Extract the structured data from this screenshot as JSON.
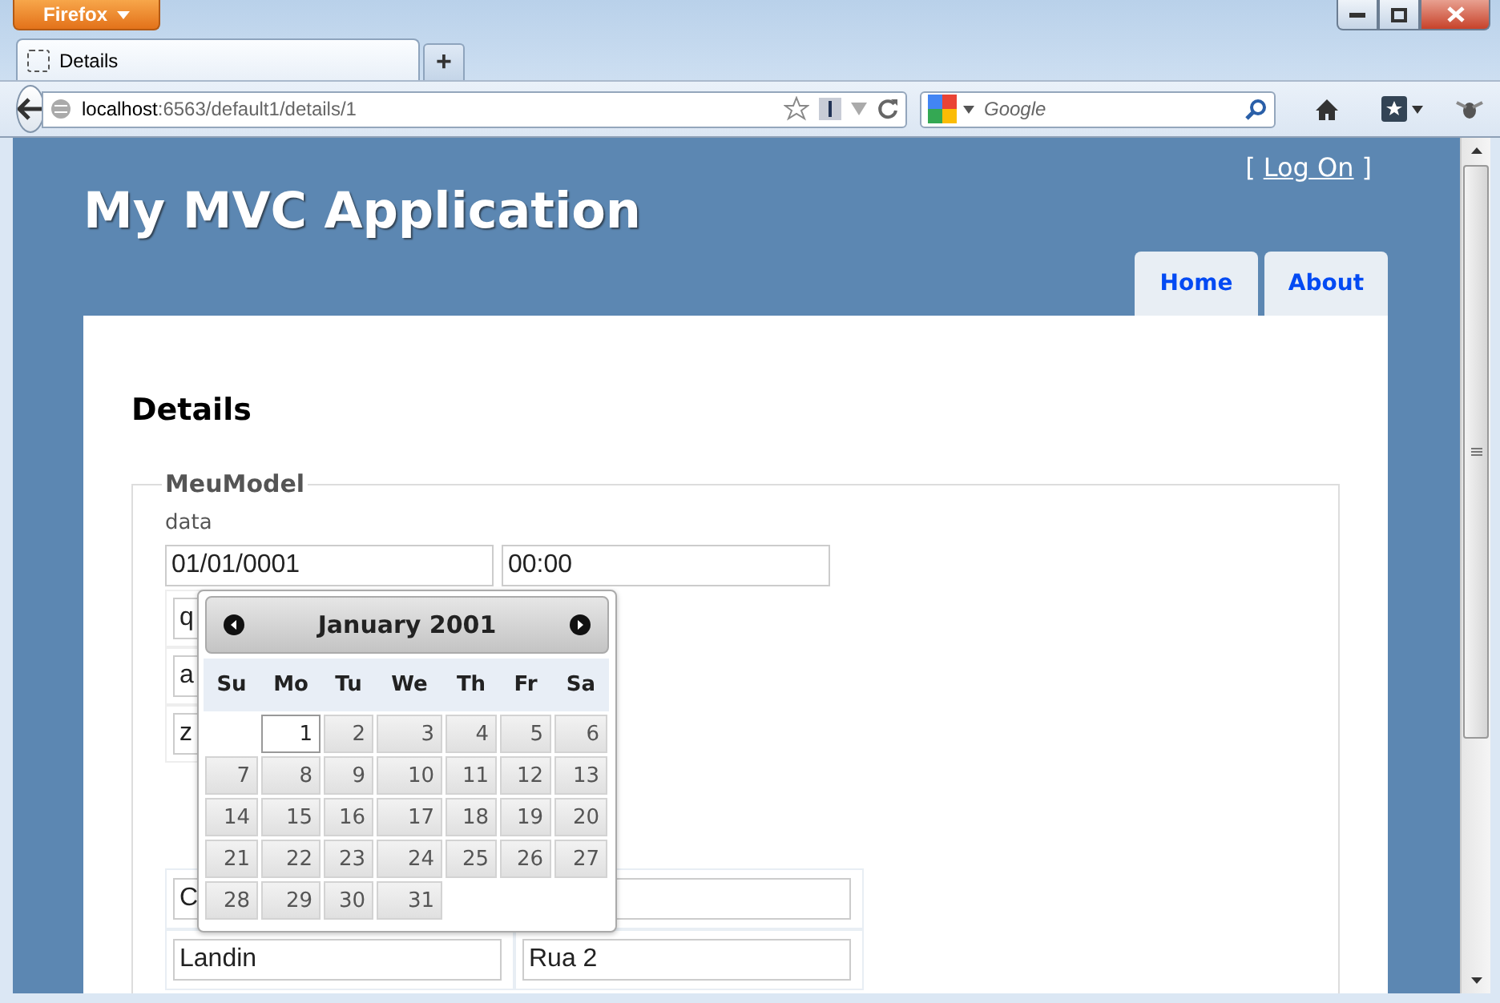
{
  "browser": {
    "menu_button": "Firefox",
    "tabs": [
      {
        "label": "Details",
        "selected": true
      }
    ],
    "new_tab": "+",
    "url_host": "localhost",
    "url_path": ":6563/default1/details/1",
    "search_placeholder": "Google"
  },
  "site": {
    "title": "My MVC Application",
    "login_open": "[",
    "login_link": "Log On",
    "login_close": "]",
    "nav": [
      {
        "label": "Home"
      },
      {
        "label": "About"
      }
    ]
  },
  "page": {
    "heading": "Details",
    "legend": "MeuModel",
    "date_label": "data",
    "date_value": "01/01/0001",
    "time_value": "00:00",
    "fields": [
      "q",
      "a",
      "z"
    ],
    "table": [
      {
        "cells": [
          "C"
        ]
      },
      {
        "cells": [
          "Landin",
          "Rua 2"
        ]
      }
    ]
  },
  "datepicker": {
    "title": "January 2001",
    "weekdays": [
      "Su",
      "Mo",
      "Tu",
      "We",
      "Th",
      "Fr",
      "Sa"
    ],
    "weeks": [
      [
        {
          "kind": "empty"
        },
        {
          "kind": "day",
          "label": "1",
          "selected": true
        },
        {
          "kind": "day",
          "label": "2",
          "selected": false
        },
        {
          "kind": "day",
          "label": "3",
          "selected": false
        },
        {
          "kind": "day",
          "label": "4",
          "selected": false
        },
        {
          "kind": "day",
          "label": "5",
          "selected": false
        },
        {
          "kind": "day",
          "label": "6",
          "selected": false
        }
      ],
      [
        {
          "kind": "day",
          "label": "7",
          "selected": false
        },
        {
          "kind": "day",
          "label": "8",
          "selected": false
        },
        {
          "kind": "day",
          "label": "9",
          "selected": false
        },
        {
          "kind": "day",
          "label": "10",
          "selected": false
        },
        {
          "kind": "day",
          "label": "11",
          "selected": false
        },
        {
          "kind": "day",
          "label": "12",
          "selected": false
        },
        {
          "kind": "day",
          "label": "13",
          "selected": false
        }
      ],
      [
        {
          "kind": "day",
          "label": "14",
          "selected": false
        },
        {
          "kind": "day",
          "label": "15",
          "selected": false
        },
        {
          "kind": "day",
          "label": "16",
          "selected": false
        },
        {
          "kind": "day",
          "label": "17",
          "selected": false
        },
        {
          "kind": "day",
          "label": "18",
          "selected": false
        },
        {
          "kind": "day",
          "label": "19",
          "selected": false
        },
        {
          "kind": "day",
          "label": "20",
          "selected": false
        }
      ],
      [
        {
          "kind": "day",
          "label": "21",
          "selected": false
        },
        {
          "kind": "day",
          "label": "22",
          "selected": false
        },
        {
          "kind": "day",
          "label": "23",
          "selected": false
        },
        {
          "kind": "day",
          "label": "24",
          "selected": false
        },
        {
          "kind": "day",
          "label": "25",
          "selected": false
        },
        {
          "kind": "day",
          "label": "26",
          "selected": false
        },
        {
          "kind": "day",
          "label": "27",
          "selected": false
        }
      ],
      [
        {
          "kind": "day",
          "label": "28",
          "selected": false
        },
        {
          "kind": "day",
          "label": "29",
          "selected": false
        },
        {
          "kind": "day",
          "label": "30",
          "selected": false
        },
        {
          "kind": "day",
          "label": "31",
          "selected": false
        }
      ]
    ]
  }
}
